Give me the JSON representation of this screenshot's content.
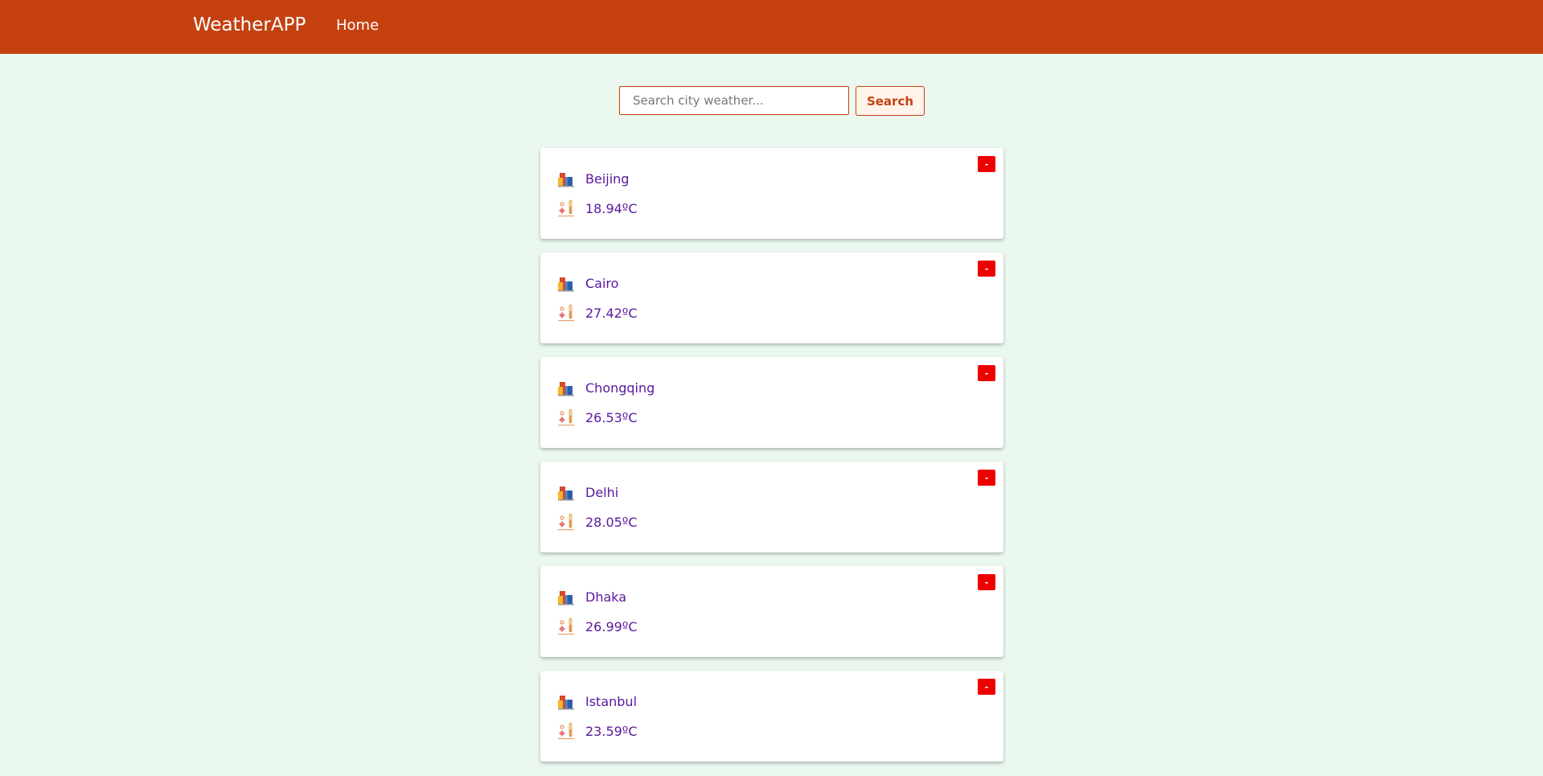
{
  "navbar": {
    "brand": "WeatherAPP",
    "home_label": "Home"
  },
  "search": {
    "placeholder": "Search city weather...",
    "button_label": "Search"
  },
  "cities": [
    {
      "name": "Beijing",
      "temperature": "18.94ºC",
      "remove_label": "-"
    },
    {
      "name": "Cairo",
      "temperature": "27.42ºC",
      "remove_label": "-"
    },
    {
      "name": "Chongqing",
      "temperature": "26.53ºC",
      "remove_label": "-"
    },
    {
      "name": "Delhi",
      "temperature": "28.05ºC",
      "remove_label": "-"
    },
    {
      "name": "Dhaka",
      "temperature": "26.99ºC",
      "remove_label": "-"
    },
    {
      "name": "Istanbul",
      "temperature": "23.59ºC",
      "remove_label": "-"
    }
  ],
  "icons": {
    "city": "buildings-icon",
    "temperature": "thermometer-icon"
  },
  "colors": {
    "navbar": "#c4410f",
    "background": "#eaf8f0",
    "text": "#5a179c",
    "remove": "#ee0000"
  }
}
